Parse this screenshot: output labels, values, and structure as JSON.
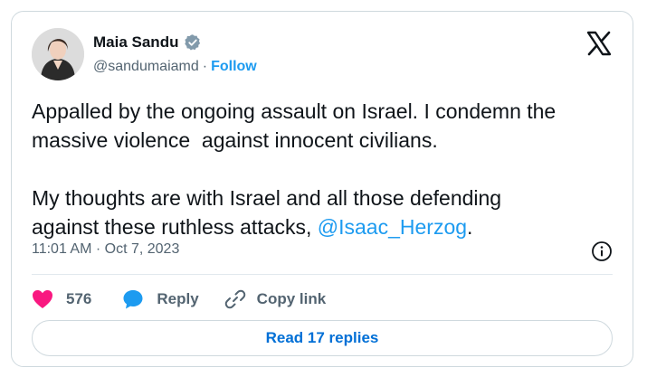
{
  "author": {
    "name": "Maia Sandu",
    "handle": "@sandumaiamd",
    "separator": "·",
    "follow_label": "Follow"
  },
  "tweet": {
    "paragraph1": "Appalled by the ongoing assault on Israel. I condemn the\nmassive violence  against innocent civilians.",
    "paragraph2_prefix": "My thoughts are with Israel and all those defending\nagainst these ruthless attacks, ",
    "mention": "@Isaac_Herzog",
    "paragraph2_suffix": ".",
    "timestamp": "11:01 AM · Oct 7, 2023"
  },
  "actions": {
    "like_count": "576",
    "reply_label": "Reply",
    "copy_link_label": "Copy link"
  },
  "read_replies_label": "Read 17 replies",
  "icons": [
    "x-logo-icon",
    "verified-badge-icon",
    "info-icon",
    "heart-icon",
    "reply-bubble-icon",
    "link-icon"
  ],
  "colors": {
    "accent": "#1d9bf0",
    "like": "#f91880",
    "text": "#0f1419",
    "muted": "#536471",
    "border": "#cfd9de"
  }
}
